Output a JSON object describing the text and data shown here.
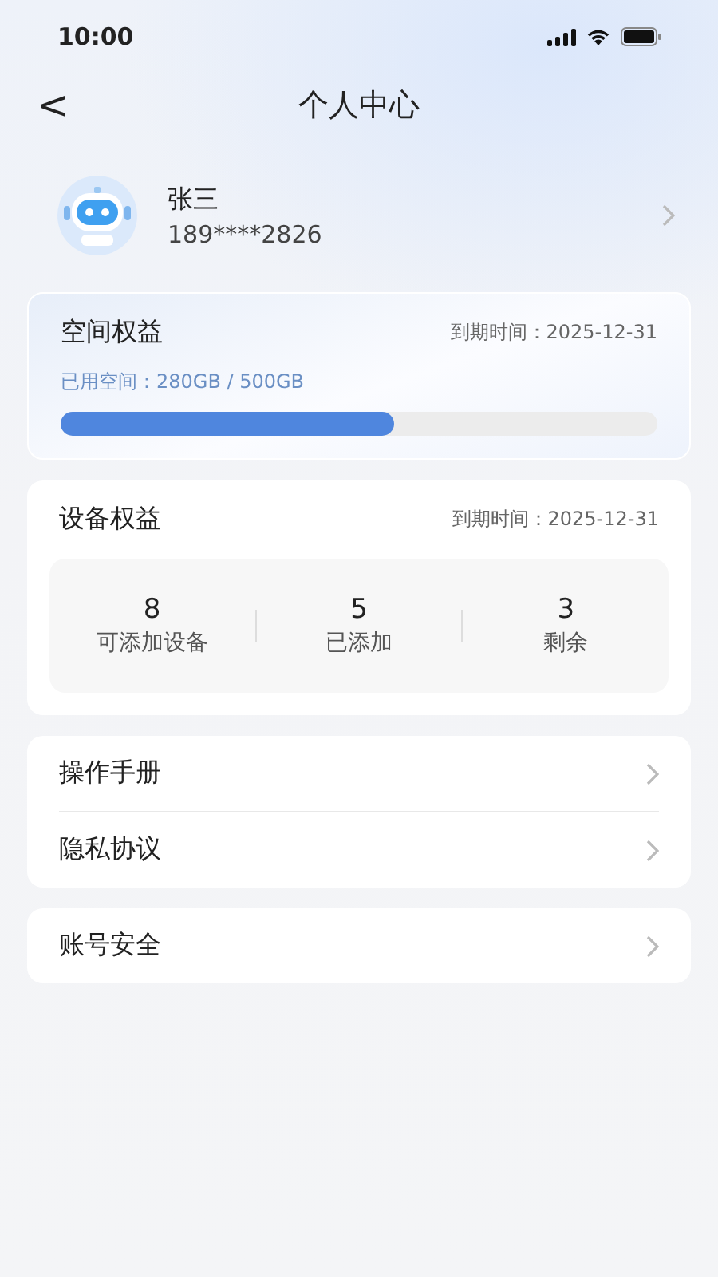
{
  "status_bar": {
    "time": "10:00"
  },
  "nav": {
    "back": "<",
    "title": "个人中心"
  },
  "profile": {
    "name": "张三",
    "phone": "189****2826"
  },
  "storage": {
    "title": "空间权益",
    "expiry": "到期时间：2025-12-31",
    "usage": "已用空间：280GB / 500GB",
    "level": 0.56
  },
  "devices": {
    "title": "设备权益",
    "expiry": "到期时间：2025-12-31",
    "stats": [
      {
        "value": "8",
        "label": "可添加设备"
      },
      {
        "value": "5",
        "label": "已添加"
      },
      {
        "value": "3",
        "label": "剩余"
      }
    ]
  },
  "menu_groups": [
    {
      "items": [
        "操作手册",
        "隐私协议"
      ]
    },
    {
      "items": [
        "账号安全"
      ]
    }
  ]
}
